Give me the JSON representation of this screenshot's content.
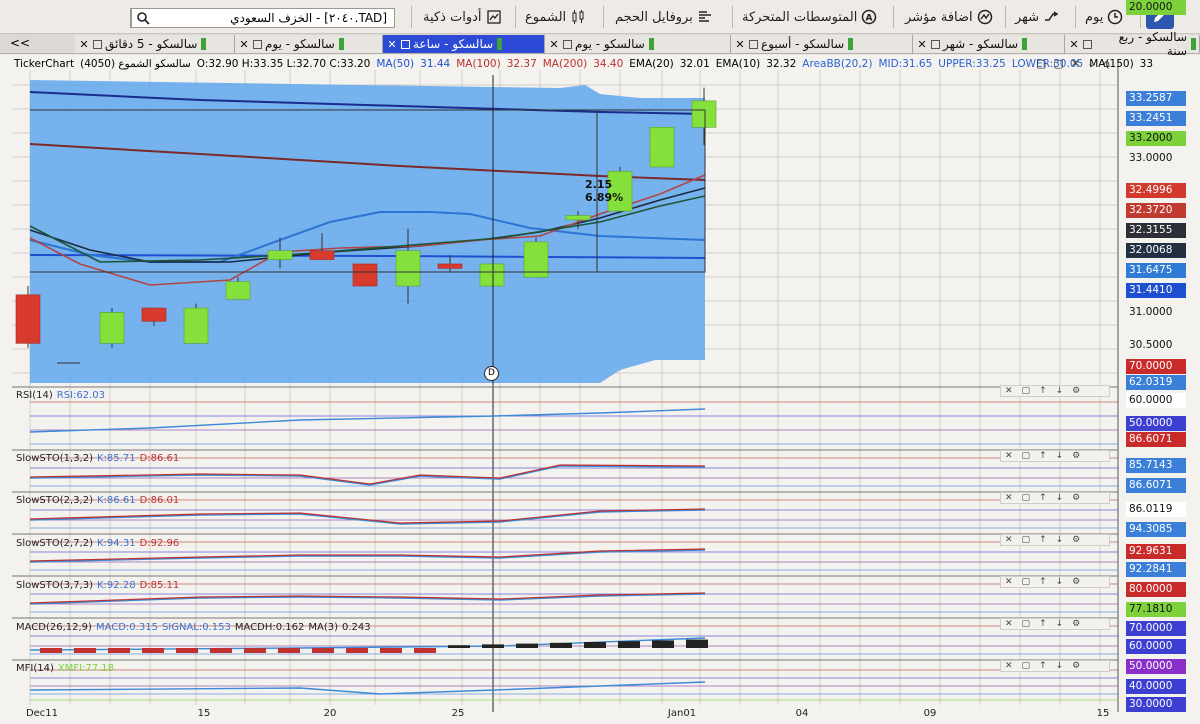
{
  "toolbar": {
    "items": [
      {
        "label": "يوم",
        "icon": "clock-icon"
      },
      {
        "label": "شهر",
        "icon": "shuffle-icon"
      },
      {
        "label": "اضافة مؤشر",
        "icon": "indicator-icon"
      },
      {
        "label": "المتوسطات المتحركة",
        "icon": "moving-average-icon"
      },
      {
        "label": "بروفايل الحجم",
        "icon": "volume-profile-icon"
      },
      {
        "label": "الشموع",
        "icon": "candles-icon"
      },
      {
        "label": "أدوات ذكية",
        "icon": "smart-tools-icon"
      }
    ],
    "search_value": "[TAD.٢٠٤٠] - الخزف السعودي"
  },
  "tabs": [
    {
      "label": "سالسكو - ربع سنة",
      "active": false
    },
    {
      "label": "سالسكو - شهر",
      "active": false
    },
    {
      "label": "سالسكو - أسبوع",
      "active": false
    },
    {
      "label": "سالسكو - يوم",
      "active": false
    },
    {
      "label": "سالسكو - ساعة",
      "active": true
    },
    {
      "label": "سالسكو - يوم",
      "active": false
    },
    {
      "label": "سالسكو - 5 دقائق",
      "active": false
    }
  ],
  "tab_scroll": "<<",
  "info": {
    "source": "TickerChart",
    "name": "سالسكو الشموع (4050)",
    "ohlc": "O:32.90 H:33.35 L:32.70 C:33.20",
    "ma50": "MA(50)",
    "ma50_val": "31.44",
    "ma100": "MA(100)",
    "ma100_val": "32.37",
    "ma200": "MA(200)",
    "ma200_val": "34.40",
    "ema20": "EMA(20)",
    "ema20_val": "32.01",
    "ema10": "EMA(10)",
    "ema10_val": "32.32",
    "areabb": "AreaBB(20,2)",
    "mid": "MID:31.65",
    "upper": "UPPER:33.25",
    "lower": "LOWER:30.05",
    "ma150": "MA(150)",
    "ma150_val": "33"
  },
  "colors": {
    "bg": "#f4f2ee",
    "blue_area": "#5fa7ec",
    "bull": "#86e03c",
    "bear": "#d83a2e",
    "grid": "#c5c2bd",
    "ma_blue": "#1f4fd1",
    "ma_dark": "#1b2a44",
    "ma_brown": "#7a2a2a"
  },
  "price_axis": [
    {
      "label": "33.2587",
      "bg": "#3c7fd8",
      "color": "#fff"
    },
    {
      "label": "33.2451",
      "bg": "#3c7fd8",
      "color": "#fff"
    },
    {
      "label": "33.2000",
      "bg": "#7dd23c",
      "color": "#111"
    },
    {
      "label": "33.0000",
      "bg": "transparent",
      "color": "#111"
    },
    {
      "label": "32.4996",
      "bg": "#d23a2e",
      "color": "#fff"
    },
    {
      "label": "32.3720",
      "bg": "#c13a2f",
      "color": "#fff"
    },
    {
      "label": "32.3155",
      "bg": "#2d2f37",
      "color": "#fff"
    },
    {
      "label": "32.0068",
      "bg": "#233042",
      "color": "#fff"
    },
    {
      "label": "31.6475",
      "bg": "#2f7bd6",
      "color": "#fff"
    },
    {
      "label": "31.4410",
      "bg": "#1f4fd1",
      "color": "#fff"
    },
    {
      "label": "31.0000",
      "bg": "transparent",
      "color": "#111"
    },
    {
      "label": "30.5000",
      "bg": "transparent",
      "color": "#111"
    },
    {
      "label": "70.0000",
      "bg": "#c92b2b",
      "color": "#fff"
    },
    {
      "label": "62.0319",
      "bg": "#3c7fd8",
      "color": "#fff"
    },
    {
      "label": "60.0000",
      "bg": "#fff",
      "color": "#111"
    },
    {
      "label": "50.0000",
      "bg": "#3d3fd0",
      "color": "#fff"
    },
    {
      "label": "86.6071",
      "bg": "#c92b2b",
      "color": "#fff"
    },
    {
      "label": "85.7143",
      "bg": "#3c7fd8",
      "color": "#fff"
    },
    {
      "label": "86.6071",
      "bg": "#3c7fd8",
      "color": "#fff"
    },
    {
      "label": "86.0119",
      "bg": "#fff",
      "color": "#111"
    },
    {
      "label": "94.3085",
      "bg": "#3c7fd8",
      "color": "#fff"
    },
    {
      "label": "92.9631",
      "bg": "#c92b2b",
      "color": "#fff"
    },
    {
      "label": "92.2841",
      "bg": "#3c7fd8",
      "color": "#fff"
    },
    {
      "label": "80.0000",
      "bg": "#c92b2b",
      "color": "#fff"
    },
    {
      "label": "77.1810",
      "bg": "#7dd23c",
      "color": "#111"
    },
    {
      "label": "70.0000",
      "bg": "#3d3fd0",
      "color": "#fff"
    },
    {
      "label": "60.0000",
      "bg": "#3d3fd0",
      "color": "#fff"
    },
    {
      "label": "50.0000",
      "bg": "#8b2fc9",
      "color": "#fff"
    },
    {
      "label": "40.0000",
      "bg": "#3d3fd0",
      "color": "#fff"
    },
    {
      "label": "30.0000",
      "bg": "#3d3fd0",
      "color": "#fff"
    },
    {
      "label": "20.0000",
      "bg": "#7dd23c",
      "color": "#111"
    }
  ],
  "annotation": {
    "line1": "2.15",
    "line2": "6.89%"
  },
  "panels": [
    {
      "name": "RSI(14)",
      "value": "RSI:62.03"
    },
    {
      "name": "SlowSTO(1,3,2)",
      "value": "K:85.71",
      "value2": "D:86.61"
    },
    {
      "name": "SlowSTO(2,3,2)",
      "value": "K:86.61",
      "value2": "D:86.01"
    },
    {
      "name": "SlowSTO(2,7,2)",
      "value": "K:94.31",
      "value2": "D:92.96"
    },
    {
      "name": "SlowSTO(3,7,3)",
      "value": "K:92.28",
      "value2": "D:85.11"
    },
    {
      "name": "MACD(26,12,9)",
      "value": "MACD:0.315",
      "value2": "SIGNAL:0.153",
      "value3": "MACDH:0.162",
      "value4": "MA(3)",
      "value5": "0.243"
    },
    {
      "name": "MFI(14)",
      "value": "XMFI:77.18"
    }
  ],
  "x_axis": [
    "Dec11",
    "15",
    "20",
    "25",
    "Jan01",
    "04",
    "09",
    "15"
  ],
  "cursor_label": "D",
  "chart_data": {
    "type": "candlestick",
    "candles": [
      {
        "o": 31.0,
        "h": 31.1,
        "l": 30.4,
        "c": 30.45
      },
      {
        "o": 30.45,
        "h": 30.85,
        "l": 30.4,
        "c": 30.8
      },
      {
        "o": 30.85,
        "h": 30.85,
        "l": 30.65,
        "c": 30.7
      },
      {
        "o": 30.45,
        "h": 30.9,
        "l": 30.45,
        "c": 30.85
      },
      {
        "o": 30.95,
        "h": 31.2,
        "l": 30.95,
        "c": 31.15
      },
      {
        "o": 31.4,
        "h": 31.65,
        "l": 31.3,
        "c": 31.5
      },
      {
        "o": 31.5,
        "h": 31.7,
        "l": 31.4,
        "c": 31.4
      },
      {
        "o": 31.35,
        "h": 31.35,
        "l": 31.1,
        "c": 31.1
      },
      {
        "o": 31.1,
        "h": 31.75,
        "l": 30.9,
        "c": 31.5
      },
      {
        "o": 31.35,
        "h": 31.45,
        "l": 31.25,
        "c": 31.3
      },
      {
        "o": 31.1,
        "h": 31.35,
        "l": 31.1,
        "c": 31.35
      },
      {
        "o": 31.2,
        "h": 31.65,
        "l": 31.2,
        "c": 31.6
      },
      {
        "o": 31.85,
        "h": 31.95,
        "l": 31.75,
        "c": 31.9
      },
      {
        "o": 31.95,
        "h": 32.45,
        "l": 31.95,
        "c": 32.4
      },
      {
        "o": 32.45,
        "h": 32.9,
        "l": 32.45,
        "c": 32.9
      },
      {
        "o": 32.9,
        "h": 33.35,
        "l": 32.7,
        "c": 33.2
      }
    ],
    "ylim": [
      30.0,
      33.55
    ],
    "y_ticks": [
      30.5,
      31.0,
      33.0
    ]
  }
}
